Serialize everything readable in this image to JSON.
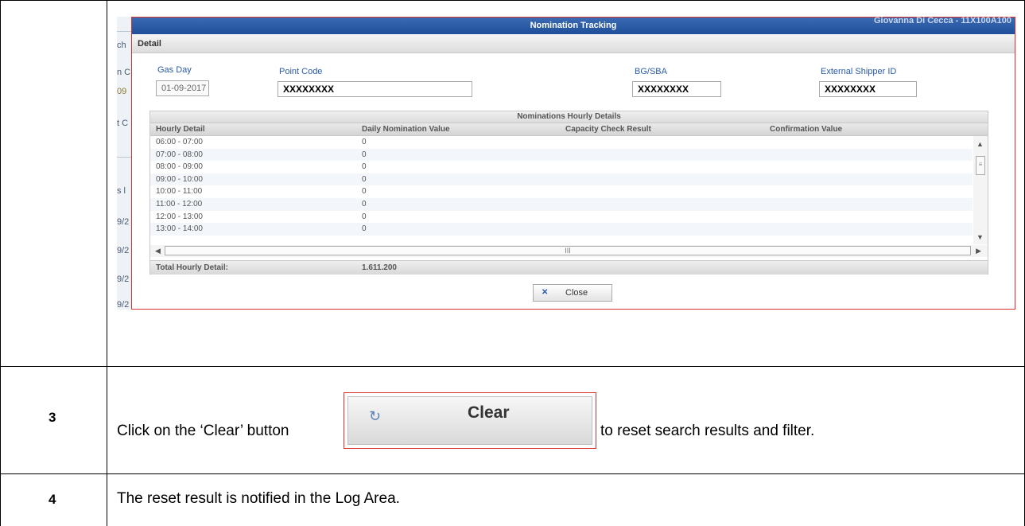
{
  "dialog": {
    "title": "Nomination Tracking",
    "user": "Giovanna Di Cecca - 11X100A100",
    "detail_label": "Detail",
    "fields": {
      "gas_day_label": "Gas Day",
      "gas_day_value": "01-09-2017",
      "point_code_label": "Point Code",
      "point_code_value": "XXXXXXXX",
      "bg_sba_label": "BG/SBA",
      "bg_sba_value": "XXXXXXXX",
      "external_shipper_label": "External Shipper ID",
      "external_shipper_value": "XXXXXXXX"
    },
    "grid": {
      "caption": "Nominations Hourly Details",
      "columns": [
        "Hourly Detail",
        "Daily Nomination Value",
        "Capacity Check Result",
        "Confirmation Value"
      ],
      "rows": [
        [
          "06:00 - 07:00",
          "0",
          "",
          ""
        ],
        [
          "07:00 - 08:00",
          "0",
          "",
          ""
        ],
        [
          "08:00 - 09:00",
          "0",
          "",
          ""
        ],
        [
          "09:00 - 10:00",
          "0",
          "",
          ""
        ],
        [
          "10:00 - 11:00",
          "0",
          "",
          ""
        ],
        [
          "11:00 - 12:00",
          "0",
          "",
          ""
        ],
        [
          "12:00 - 13:00",
          "0",
          "",
          ""
        ],
        [
          "13:00 - 14:00",
          "0",
          "",
          ""
        ]
      ],
      "total_label": "Total Hourly Detail:",
      "total_value": "1.611.200",
      "scroll_grip": "III"
    },
    "close_label": "Close",
    "close_icon": "x-icon"
  },
  "steps": [
    {
      "number": "3",
      "text_before": "Click on the ‘Clear’ button",
      "text_after": "to reset search results and filter.",
      "button_label": "Clear",
      "button_icon": "refresh-icon"
    },
    {
      "number": "4",
      "text": "The reset result is notified in the Log Area."
    }
  ],
  "colors": {
    "highlight_border": "#d9302c",
    "title_bar": "#1f4e9a",
    "label_blue": "#2a5aa8"
  }
}
